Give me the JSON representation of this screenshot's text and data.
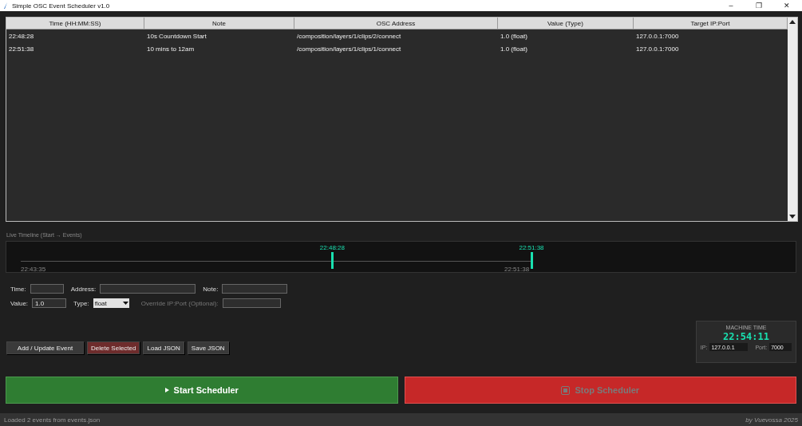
{
  "window": {
    "title": "Simple OSC Event Scheduler v1.0",
    "controls": [
      "–",
      "❐",
      "✕"
    ]
  },
  "table": {
    "columns": [
      "Time (HH:MM:SS)",
      "Note",
      "OSC Address",
      "Value (Type)",
      "Target IP:Port"
    ],
    "rows": [
      {
        "cells": [
          "22:48:28",
          "10s Countdown Start",
          "/composition/layers/1/clips/2/connect",
          "1.0 (float)",
          "127.0.0.1:7000"
        ],
        "selected": false
      },
      {
        "cells": [
          "22:51:38",
          "10 mins to 12am",
          "/composition/layers/1/clips/1/connect",
          "1.0 (float)",
          "127.0.0.1:7000"
        ],
        "selected": false
      }
    ]
  },
  "timeline": {
    "title": "Live Timeline (Start → Events)",
    "start_label": "22:43:35",
    "end_label": "22:51:38",
    "markers": [
      {
        "label": "22:48:28",
        "level": 0.61
      },
      {
        "label": "22:51:38",
        "level": 1.0
      }
    ]
  },
  "form": {
    "time": {
      "label": "Time:"
    },
    "address": {
      "label": "Address:"
    },
    "note": {
      "label": "Note:"
    },
    "value": {
      "label": "Value:",
      "value": "1.0"
    },
    "type": {
      "label": "Type:",
      "value": "float"
    },
    "override": {
      "label": "Override IP:Port (Optional):"
    }
  },
  "actions": [
    {
      "label": "Add / Update Event",
      "kind": "neutral"
    },
    {
      "label": "Delete Selected",
      "kind": "danger"
    },
    {
      "label": "Load JSON",
      "kind": "neutral"
    },
    {
      "label": "Save JSON",
      "kind": "neutral"
    }
  ],
  "machine": {
    "title": "MACHINE TIME",
    "time": "22:54:11",
    "ip_label": "IP:",
    "ip": "127.0.0.1",
    "port_label": "Port:",
    "port": "7000"
  },
  "scheduler": [
    {
      "label": "Start Scheduler",
      "kind": "start",
      "disabled": false
    },
    {
      "label": "Stop Scheduler",
      "kind": "stop",
      "disabled": true
    }
  ],
  "status_bar": {
    "message": "Loaded 2 events from events.json",
    "credit": "by Vuevossa 2025"
  }
}
